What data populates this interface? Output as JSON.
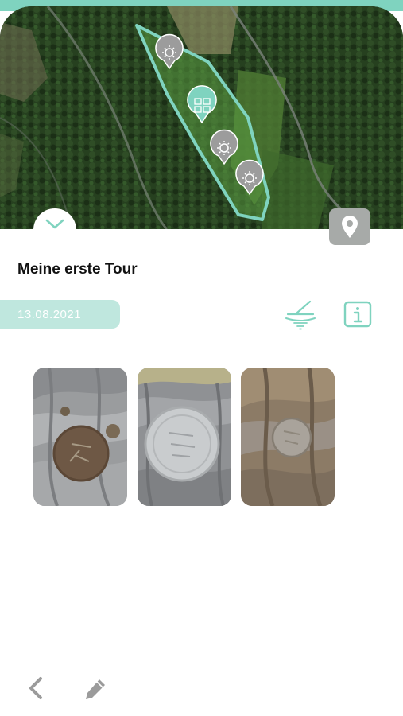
{
  "tour": {
    "title": "Meine erste Tour",
    "date": "13.08.2021"
  },
  "map": {
    "area_color": "#7fd3bf",
    "markers": [
      "sun-marker-icon",
      "picture-marker-icon",
      "sun-marker-icon",
      "sun-marker-icon"
    ]
  },
  "actions": {
    "collapse_icon": "chevron-down-icon",
    "location_icon": "location-pin-icon",
    "detector_icon": "metal-detector-icon",
    "info_icon": "info-icon",
    "back_icon": "chevron-left-icon",
    "edit_icon": "pencil-icon"
  },
  "photos": [
    {
      "subject": "dark corroded coin on glove"
    },
    {
      "subject": "silver coin on glove"
    },
    {
      "subject": "small coin in dirt on glove"
    }
  ],
  "colors": {
    "accent": "#7fd3bf",
    "accent_dark": "#5bbba4",
    "date_badge": "#bfe7de",
    "location_button": "#a7aaa8",
    "nav_icon": "#9b9b9b"
  }
}
